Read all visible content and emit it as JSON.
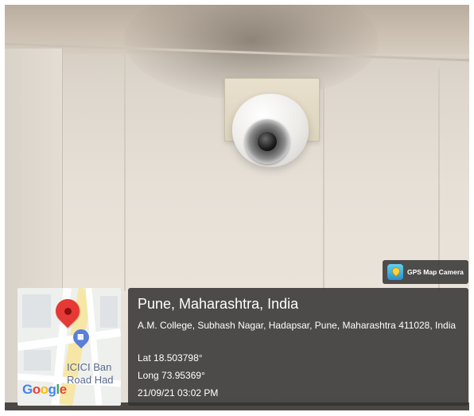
{
  "badge": {
    "label": "GPS Map Camera",
    "icon": "gps-map-camera-app-icon"
  },
  "map": {
    "poi_line1": "ICICI Ban",
    "poi_line2": "Road Had",
    "logo_letters": [
      "G",
      "o",
      "o",
      "g",
      "l",
      "e"
    ],
    "pin_icon": "location-pin-icon",
    "bank_icon": "bank-icon"
  },
  "location": {
    "title": "Pune, Maharashtra, India",
    "address": "A.M. College, Subhash Nagar, Hadapsar, Pune, Maharashtra 411028, India",
    "latitude": "Lat 18.503798°",
    "longitude": "Long 73.95369°",
    "datetime": "21/09/21 03:02 PM"
  },
  "colors": {
    "overlay_bg": "#323232",
    "pin_red": "#e53935",
    "badge_icon": "#2a8fd0"
  }
}
